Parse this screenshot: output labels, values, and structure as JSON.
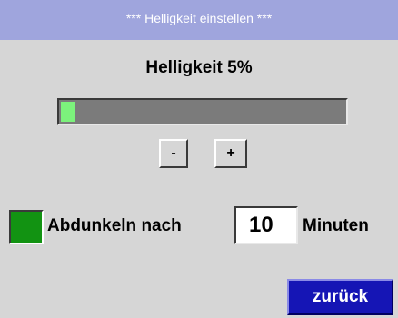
{
  "window": {
    "title": "***  Helligkeit einstellen ***"
  },
  "brightness": {
    "label": "Helligkeit 5%",
    "level_percent": 5
  },
  "controls": {
    "decrease_label": "-",
    "increase_label": "+"
  },
  "dimming": {
    "enabled": true,
    "label": "Abdunkeln nach",
    "minutes_value": "10",
    "unit_label": "Minuten"
  },
  "footer": {
    "back_label": "zurück"
  },
  "colors": {
    "title_bar": "#9fa5dd",
    "background": "#d6d6d6",
    "bar_fill": "#7cf27c",
    "checkbox_on": "#129312",
    "back_button": "#1515b5"
  }
}
